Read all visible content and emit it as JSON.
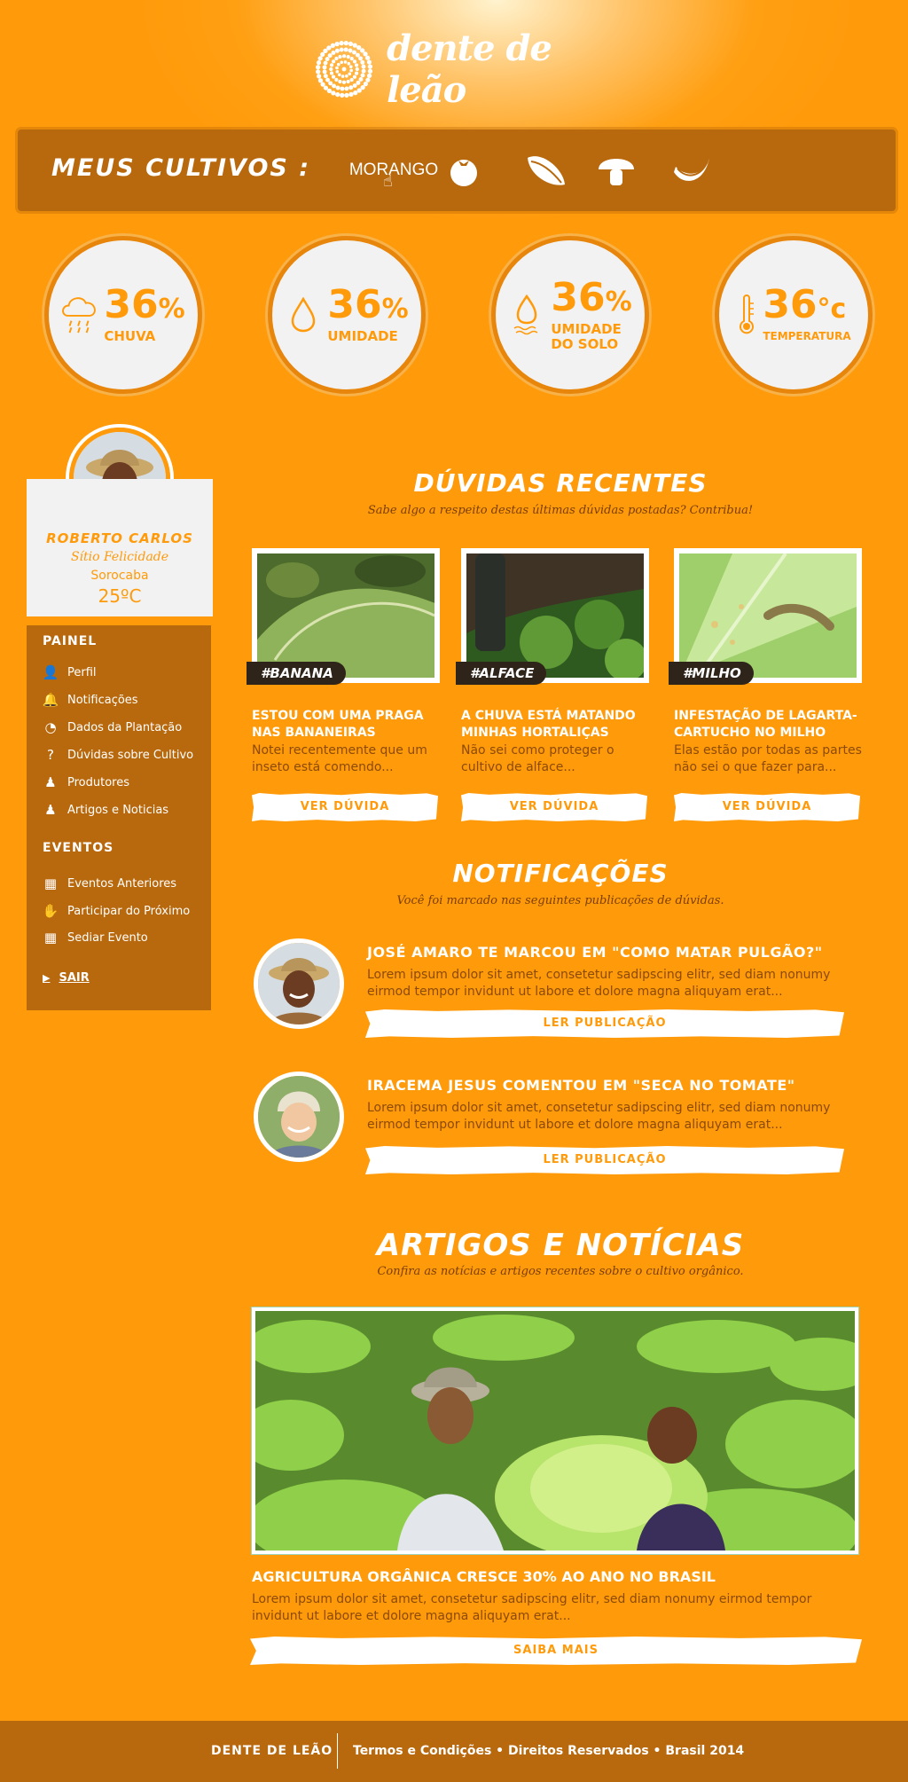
{
  "brand": {
    "name": "dente de leão"
  },
  "crops": {
    "title": "MEUS CULTIVOS :",
    "items": [
      {
        "label": "MORANGO",
        "icon": "strawberry-icon"
      },
      {
        "label": "",
        "icon": "tomato-icon"
      },
      {
        "label": "",
        "icon": "bean-icon"
      },
      {
        "label": "",
        "icon": "mushroom-icon"
      },
      {
        "label": "",
        "icon": "banana-icon"
      }
    ]
  },
  "stats": [
    {
      "value": "36",
      "unit": "%",
      "label": "CHUVA",
      "label2": "",
      "icon": "rain-cloud-icon"
    },
    {
      "value": "36",
      "unit": "%",
      "label": "UMIDADE",
      "label2": "",
      "icon": "water-drop-icon"
    },
    {
      "value": "36",
      "unit": "%",
      "label": "UMIDADE",
      "label2": "DO SOLO",
      "icon": "soil-moisture-icon"
    },
    {
      "value": "36",
      "unit": "°c",
      "label": "TEMPERATURA",
      "label2": "",
      "icon": "thermometer-icon"
    }
  ],
  "profile": {
    "name": "ROBERTO CARLOS",
    "farm": "Sítio Felicidade",
    "city": "Sorocaba",
    "temp": "25ºC"
  },
  "panel": {
    "title": "PAINEL",
    "items": [
      {
        "label": "Perfil",
        "icon": "user-icon"
      },
      {
        "label": "Notificações",
        "icon": "bell-icon"
      },
      {
        "label": "Dados da Plantação",
        "icon": "pie-chart-icon"
      },
      {
        "label": "Dúvidas sobre Cultivo",
        "icon": "question-icon"
      },
      {
        "label": "Produtores",
        "icon": "farmer-icon"
      },
      {
        "label": "Artigos e Noticias",
        "icon": "article-icon"
      }
    ],
    "events_title": "EVENTOS",
    "events": [
      {
        "label": "Eventos Anteriores",
        "icon": "calendar-icon"
      },
      {
        "label": "Participar do Próximo",
        "icon": "hand-icon"
      },
      {
        "label": "Sediar Evento",
        "icon": "calendar-add-icon"
      }
    ],
    "logout": "SAIR"
  },
  "questions": {
    "title": "DÚVIDAS RECENTES",
    "subtitle": "Sabe algo a respeito destas últimas dúvidas postadas? Contribua!",
    "button": "VER DÚVIDA",
    "items": [
      {
        "tag": "#BANANA",
        "title": "ESTOU COM UMA PRAGA NAS BANANEIRAS",
        "text": "Notei recentemente que um inseto está comendo..."
      },
      {
        "tag": "#ALFACE",
        "title": "A CHUVA ESTÁ MATANDO MINHAS HORTALIÇAS",
        "text": "Não sei como proteger o cultivo de alface..."
      },
      {
        "tag": "#MILHO",
        "title": "INFESTAÇÃO DE LAGARTA-CARTUCHO NO MILHO",
        "text": "Elas estão por todas as partes não sei o que fazer para..."
      }
    ]
  },
  "notifications": {
    "title": "NOTIFICAÇÕES",
    "subtitle": "Você foi marcado nas seguintes publicações de dúvidas.",
    "button": "LER PUBLICAÇÃO",
    "items": [
      {
        "title": "JOSÉ AMARO TE MARCOU EM \"COMO MATAR PULGÃO?\"",
        "text": "Lorem ipsum dolor sit amet, consetetur sadipscing elitr, sed diam nonumy eirmod tempor invidunt ut labore et dolore magna aliquyam erat..."
      },
      {
        "title": "IRACEMA JESUS COMENTOU EM \"SECA NO TOMATE\"",
        "text": "Lorem ipsum dolor sit amet, consetetur sadipscing elitr, sed diam nonumy eirmod tempor invidunt ut labore et dolore magna aliquyam erat..."
      }
    ]
  },
  "articles": {
    "title": "ARTIGOS E NOTÍCIAS",
    "subtitle": "Confira as notícias e artigos recentes sobre o cultivo orgânico.",
    "headline": "AGRICULTURA ORGÂNICA CRESCE 30% AO ANO NO BRASIL",
    "text": "Lorem ipsum dolor sit amet, consetetur sadipscing elitr, sed diam nonumy eirmod tempor invidunt ut labore et dolore magna aliquyam erat...",
    "button": "SAIBA MAIS"
  },
  "footer": {
    "brand": "DENTE DE LEÃO",
    "text": "Termos e Condições • Direitos Reservados • Brasil 2014"
  },
  "colors": {
    "background": "#ff9a0a",
    "panel": "#b9690d",
    "text_dark": "#8b4a07"
  }
}
